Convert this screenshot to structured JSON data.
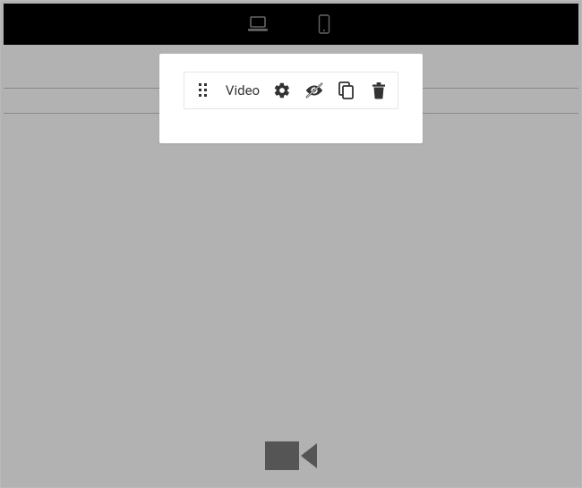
{
  "colors": {
    "icon_dark": "#333333",
    "icon_light": "#666666",
    "canvas_bg": "#b2b2b2"
  },
  "device_bar": {
    "desktop_icon": "laptop-icon",
    "mobile_icon": "phone-icon"
  },
  "toolbar": {
    "block_label": "Video",
    "drag_icon": "drag-handle-icon",
    "settings_icon": "gear-icon",
    "visibility_icon": "eye-slash-icon",
    "duplicate_icon": "copy-icon",
    "delete_icon": "trash-icon"
  },
  "placeholder": {
    "icon": "video-camera-icon"
  }
}
